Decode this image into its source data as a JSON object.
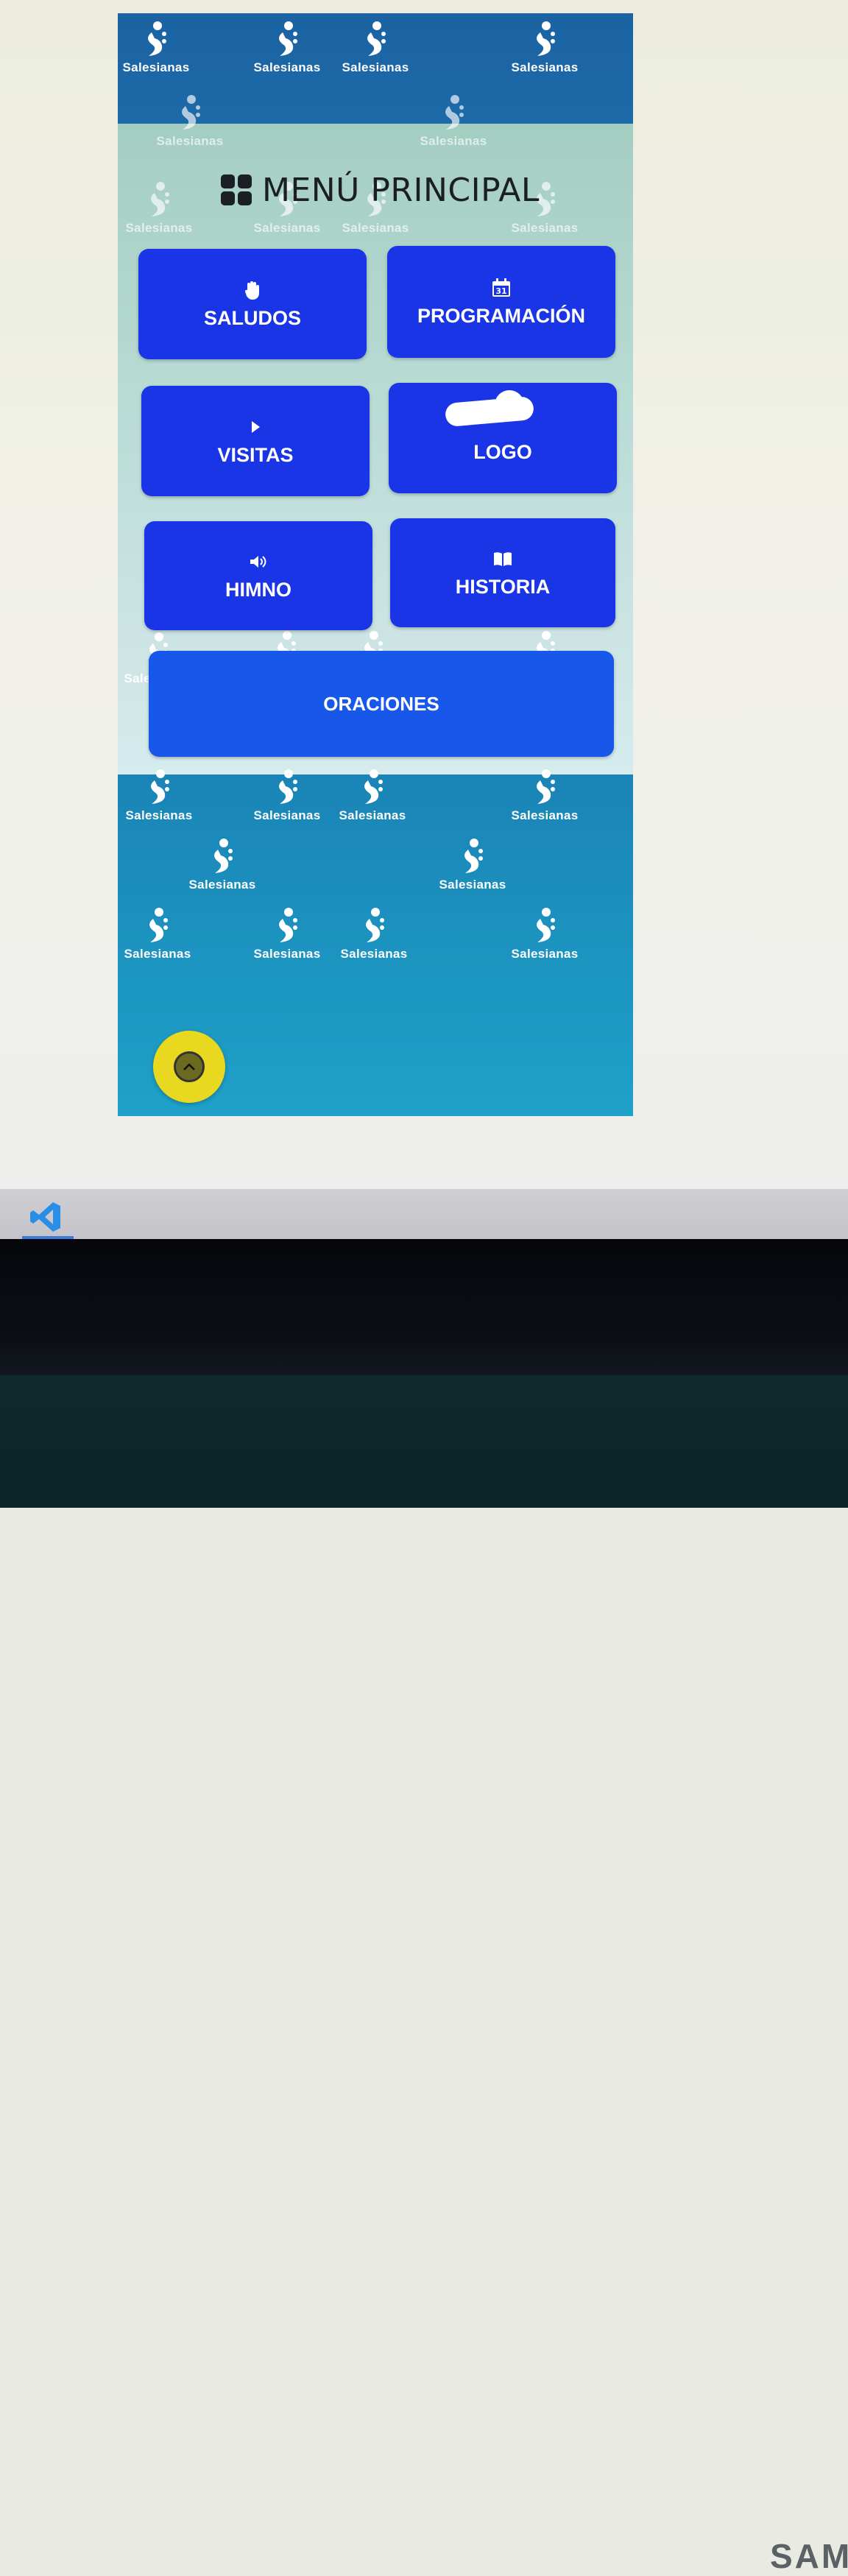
{
  "app": {
    "title": "MENÚ PRINCIPAL",
    "watermark": "Salesianas",
    "menu": [
      {
        "label": "SALUDOS",
        "icon": "hand-icon"
      },
      {
        "label": "PROGRAMACIÓN",
        "icon": "calendar-icon",
        "icon_text": "31"
      },
      {
        "label": "VISITAS",
        "icon": "play-icon"
      },
      {
        "label": "LOGO",
        "icon": "logo-icon"
      },
      {
        "label": "HIMNO",
        "icon": "speaker-icon"
      },
      {
        "label": "HISTORIA",
        "icon": "book-icon"
      },
      {
        "label": "ORACIONES",
        "icon": ""
      }
    ],
    "scroll_top_icon": "chevron-up-icon",
    "colors": {
      "button": "#1a35e6",
      "header_band": "#1b63a3",
      "footer_band": "#1ea1c9",
      "fab": "#e8d81f"
    }
  },
  "taskbar": {
    "apps": [
      {
        "name": "vscode-icon"
      }
    ]
  },
  "monitor": {
    "brand": "SAM"
  }
}
